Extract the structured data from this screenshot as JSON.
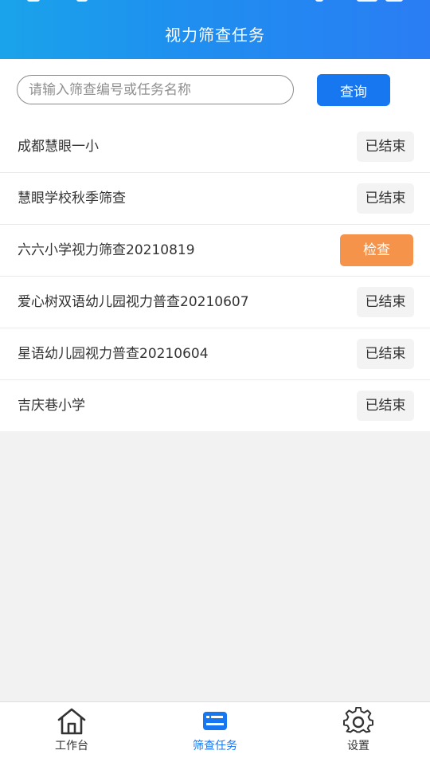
{
  "header": {
    "title": "视力筛查任务"
  },
  "search": {
    "placeholder": "请输入筛查编号或任务名称",
    "button_label": "查询"
  },
  "tasks": [
    {
      "name": "成都慧眼一小",
      "action": "已结束",
      "status": "ended"
    },
    {
      "name": "慧眼学校秋季筛查",
      "action": "已结束",
      "status": "ended"
    },
    {
      "name": "六六小学视力筛查20210819",
      "action": "检查",
      "status": "active"
    },
    {
      "name": "爱心树双语幼儿园视力普查20210607",
      "action": "已结束",
      "status": "ended"
    },
    {
      "name": "星语幼儿园视力普查20210604",
      "action": "已结束",
      "status": "ended"
    },
    {
      "name": "吉庆巷小学",
      "action": "已结束",
      "status": "ended"
    }
  ],
  "tabbar": {
    "items": [
      {
        "label": "工作台",
        "icon": "home-icon",
        "active": false
      },
      {
        "label": "筛查任务",
        "icon": "task-card-icon",
        "active": true
      },
      {
        "label": "设置",
        "icon": "gear-icon",
        "active": false
      }
    ]
  },
  "colors": {
    "header_gradient_start": "#1aa3ea",
    "header_gradient_end": "#2a7df3",
    "primary_blue": "#1677f0",
    "check_orange": "#f5934a",
    "ended_bg": "#f3f3f3",
    "page_bg": "#f2f2f2"
  }
}
